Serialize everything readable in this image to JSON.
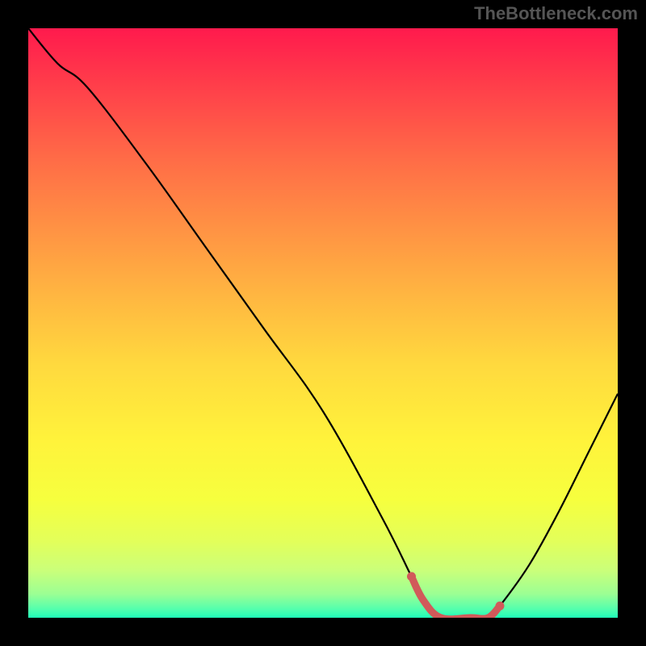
{
  "watermark": "TheBottleneck.com",
  "chart_data": {
    "type": "line",
    "title": "",
    "xlabel": "",
    "ylabel": "",
    "xlim": [
      0,
      100
    ],
    "ylim": [
      0,
      100
    ],
    "grid": false,
    "legend": false,
    "series": [
      {
        "name": "bottleneck-curve",
        "x": [
          0,
          5,
          10,
          20,
          30,
          40,
          50,
          60,
          65,
          67,
          70,
          75,
          78,
          80,
          85,
          90,
          95,
          100
        ],
        "y": [
          100,
          94,
          90,
          77,
          63,
          49,
          35,
          17,
          7,
          3,
          0,
          0,
          0,
          2,
          9,
          18,
          28,
          38
        ]
      }
    ],
    "highlight": {
      "name": "optimal-range",
      "x": [
        65,
        67,
        70,
        75,
        78,
        80
      ],
      "y": [
        7,
        3,
        0,
        0,
        0,
        2
      ],
      "color": "#d15a5a"
    },
    "background_gradient": {
      "top": "#ff1a4d",
      "mid_upper": "#ff8f44",
      "mid": "#ffd93e",
      "mid_lower": "#f6ff3e",
      "bottom": "#1fffb8"
    }
  }
}
